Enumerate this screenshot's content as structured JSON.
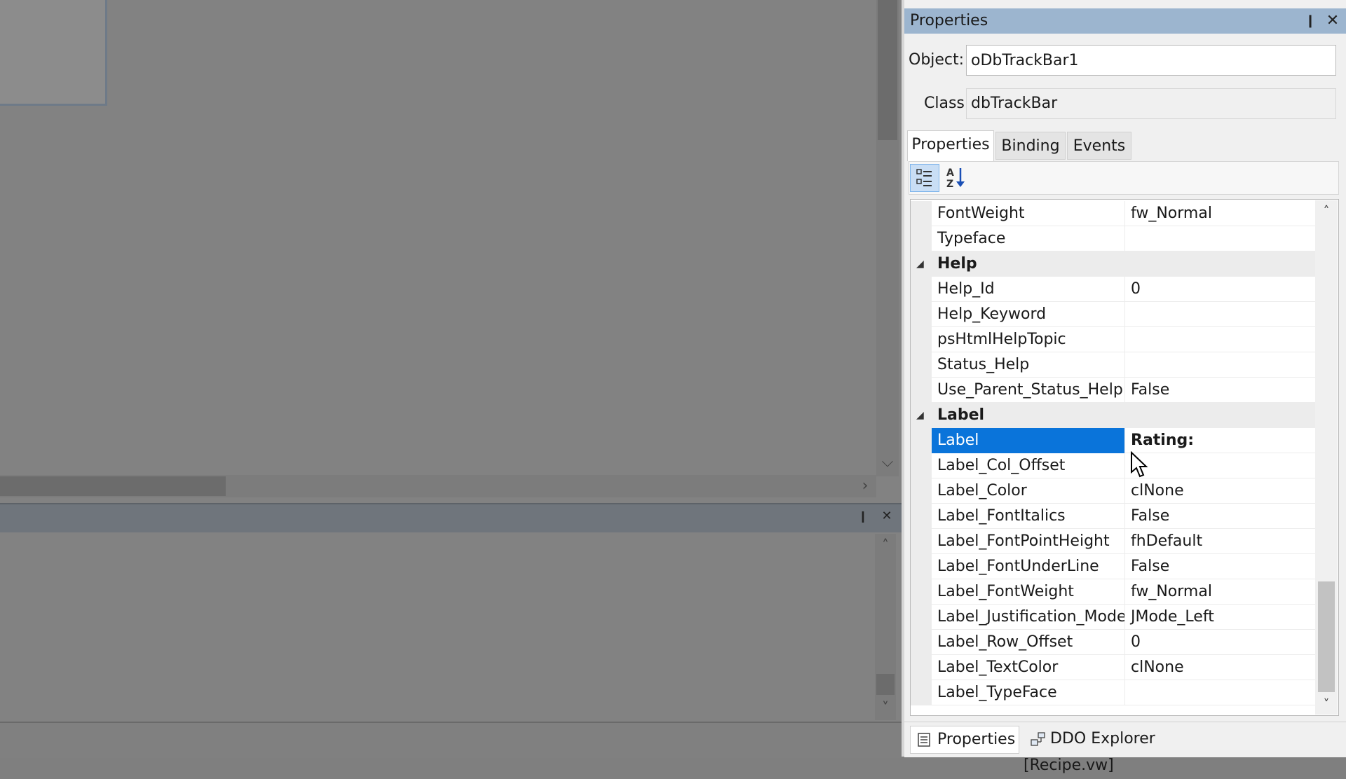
{
  "panel": {
    "title": "Properties",
    "pin_glyph": "❙",
    "close_glyph": "✕"
  },
  "object": {
    "label": "Object:",
    "value": "oDbTrackBar1"
  },
  "class": {
    "label": "Class",
    "value": "dbTrackBar"
  },
  "tabs": {
    "properties": "Properties",
    "binding": "Binding",
    "events": "Events"
  },
  "toolbar": {
    "categorized_icon": "categorized-icon",
    "alpha_icon": "sort-alphabetical-icon"
  },
  "grid": {
    "rows": [
      {
        "type": "prop",
        "name": "FontWeight",
        "value": "fw_Normal"
      },
      {
        "type": "prop",
        "name": "Typeface",
        "value": ""
      },
      {
        "type": "cat",
        "name": "Help"
      },
      {
        "type": "prop",
        "name": "Help_Id",
        "value": "0"
      },
      {
        "type": "prop",
        "name": "Help_Keyword",
        "value": ""
      },
      {
        "type": "prop",
        "name": "psHtmlHelpTopic",
        "value": ""
      },
      {
        "type": "prop",
        "name": "Status_Help",
        "value": ""
      },
      {
        "type": "prop",
        "name": "Use_Parent_Status_Help",
        "value": "False"
      },
      {
        "type": "cat",
        "name": "Label"
      },
      {
        "type": "prop",
        "name": "Label",
        "value": "Rating:",
        "selected": true
      },
      {
        "type": "prop",
        "name": "Label_Col_Offset",
        "value": ""
      },
      {
        "type": "prop",
        "name": "Label_Color",
        "value": "clNone"
      },
      {
        "type": "prop",
        "name": "Label_FontItalics",
        "value": "False"
      },
      {
        "type": "prop",
        "name": "Label_FontPointHeight",
        "value": "fhDefault"
      },
      {
        "type": "prop",
        "name": "Label_FontUnderLine",
        "value": "False"
      },
      {
        "type": "prop",
        "name": "Label_FontWeight",
        "value": "fw_Normal"
      },
      {
        "type": "prop",
        "name": "Label_Justification_Mode",
        "value": "JMode_Left"
      },
      {
        "type": "prop",
        "name": "Label_Row_Offset",
        "value": "0"
      },
      {
        "type": "prop",
        "name": "Label_TextColor",
        "value": "clNone"
      },
      {
        "type": "prop",
        "name": "Label_TypeFace",
        "value": ""
      }
    ]
  },
  "bottom_tabs": {
    "properties": "Properties",
    "ddo_explorer": "DDO Explorer [Recipe.vw]"
  },
  "colors": {
    "title_bar": "#9cb5cf",
    "selection": "#0a74da",
    "designer_bg": "#828282"
  }
}
